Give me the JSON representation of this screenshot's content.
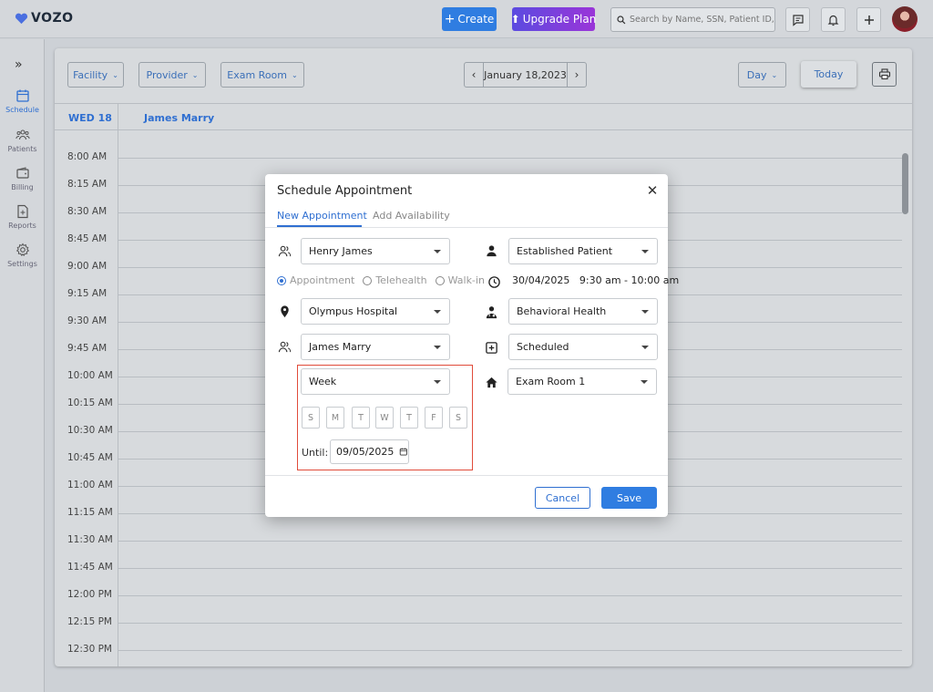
{
  "app": {
    "logo_text": "VOZO"
  },
  "topbar": {
    "create_label": "Create",
    "upgrade_label": "Upgrade Plan",
    "search_placeholder": "Search by Name, SSN, Patient ID, Phone"
  },
  "sidebar": {
    "items": [
      {
        "label": "Schedule",
        "icon": "calendar-icon"
      },
      {
        "label": "Patients",
        "icon": "users-icon"
      },
      {
        "label": "Billing",
        "icon": "wallet-icon"
      },
      {
        "label": "Reports",
        "icon": "report-icon"
      },
      {
        "label": "Settings",
        "icon": "gear-icon"
      }
    ]
  },
  "toolbar": {
    "facility": "Facility",
    "provider": "Provider",
    "exam_room": "Exam Room",
    "date": "January 18,2023",
    "view": "Day",
    "today": "Today"
  },
  "calendar": {
    "day_label": "WED 18",
    "provider_name": "James Marry",
    "times": [
      "8:00 AM",
      "8:15 AM",
      "8:30 AM",
      "8:45 AM",
      "9:00 AM",
      "9:15 AM",
      "9:30 AM",
      "9:45 AM",
      "10:00 AM",
      "10:15 AM",
      "10:30 AM",
      "10:45 AM",
      "11:00 AM",
      "11:15 AM",
      "11:30 AM",
      "11:45 AM",
      "12:00 PM",
      "12:15 PM",
      "12:30 PM"
    ]
  },
  "modal": {
    "title": "Schedule Appointment",
    "tabs": {
      "new": "New Appointment",
      "availability": "Add Availability"
    },
    "patient": "Henry James",
    "patient_type": "Established Patient",
    "visit_types": [
      "Appointment",
      "Telehealth",
      "Walk-in"
    ],
    "datetime": "30/04/2025   9:30 am - 10:00 am",
    "facility": "Olympus Hospital",
    "specialty": "Behavioral Health",
    "provider": "James Marry",
    "status": "Scheduled",
    "recurrence": "Week",
    "exam_room": "Exam Room 1",
    "weekdays": [
      "S",
      "M",
      "T",
      "W",
      "T",
      "F",
      "S"
    ],
    "until_label": "Until:",
    "until_date": "09/05/2025",
    "cancel_label": "Cancel",
    "save_label": "Save"
  },
  "colors": {
    "accent": "#2f7de1",
    "highlight": "#e04b3a"
  }
}
